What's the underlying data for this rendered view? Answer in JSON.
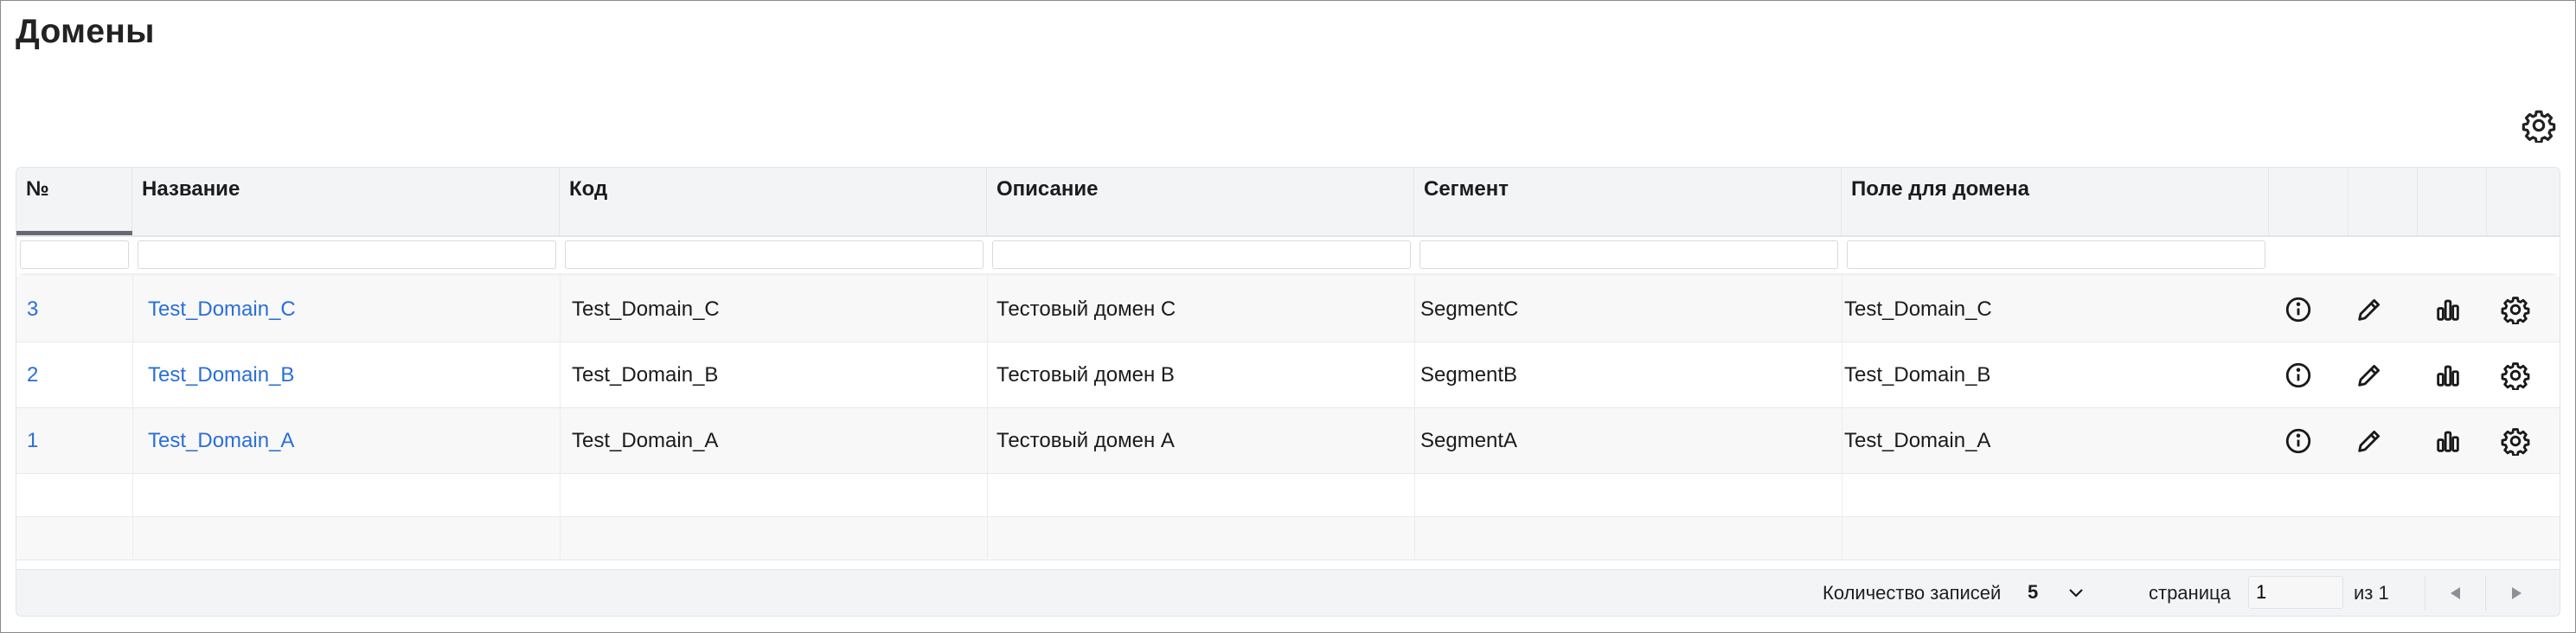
{
  "page": {
    "title": "Домены"
  },
  "table": {
    "columns": [
      "№",
      "Название",
      "Код",
      "Описание",
      "Сегмент",
      "Поле для домена"
    ],
    "rows": [
      {
        "num": "3",
        "name": "Test_Domain_C",
        "code": "Test_Domain_C",
        "description": "Тестовый домен С",
        "segment": "SegmentC",
        "domain_field": "Test_Domain_C"
      },
      {
        "num": "2",
        "name": "Test_Domain_B",
        "code": "Test_Domain_B",
        "description": "Тестовый домен В",
        "segment": "SegmentB",
        "domain_field": "Test_Domain_B"
      },
      {
        "num": "1",
        "name": "Test_Domain_A",
        "code": "Test_Domain_A",
        "description": "Тестовый домен А",
        "segment": "SegmentA",
        "domain_field": "Test_Domain_A"
      }
    ],
    "row_actions": [
      "info-icon",
      "pencil-icon",
      "bar-chart-icon",
      "gear-icon"
    ]
  },
  "footer": {
    "records_label": "Количество записей",
    "page_size": "5",
    "page_label": "страница",
    "current_page": "1",
    "of_label": "из 1"
  },
  "colors": {
    "link": "#2a6fd6",
    "header_bg": "#f3f4f6",
    "alt_row_bg": "#f8f8f9"
  }
}
